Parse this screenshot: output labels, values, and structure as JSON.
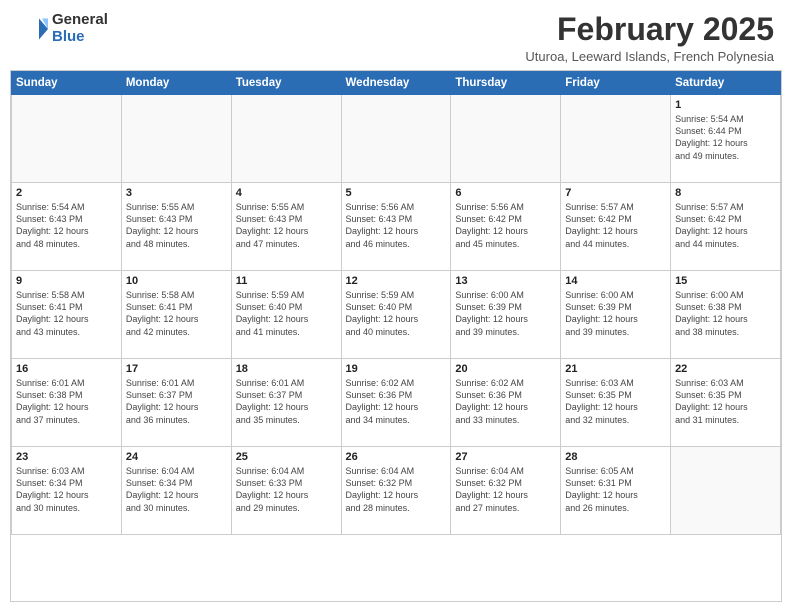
{
  "header": {
    "logo": {
      "general": "General",
      "blue": "Blue"
    },
    "title": "February 2025",
    "subtitle": "Uturoa, Leeward Islands, French Polynesia"
  },
  "days_of_week": [
    "Sunday",
    "Monday",
    "Tuesday",
    "Wednesday",
    "Thursday",
    "Friday",
    "Saturday"
  ],
  "weeks": [
    [
      {
        "day": null,
        "info": null
      },
      {
        "day": null,
        "info": null
      },
      {
        "day": null,
        "info": null
      },
      {
        "day": null,
        "info": null
      },
      {
        "day": null,
        "info": null
      },
      {
        "day": null,
        "info": null
      },
      {
        "day": "1",
        "info": "Sunrise: 5:54 AM\nSunset: 6:44 PM\nDaylight: 12 hours\nand 49 minutes."
      }
    ],
    [
      {
        "day": "2",
        "info": "Sunrise: 5:54 AM\nSunset: 6:43 PM\nDaylight: 12 hours\nand 48 minutes."
      },
      {
        "day": "3",
        "info": "Sunrise: 5:55 AM\nSunset: 6:43 PM\nDaylight: 12 hours\nand 48 minutes."
      },
      {
        "day": "4",
        "info": "Sunrise: 5:55 AM\nSunset: 6:43 PM\nDaylight: 12 hours\nand 47 minutes."
      },
      {
        "day": "5",
        "info": "Sunrise: 5:56 AM\nSunset: 6:43 PM\nDaylight: 12 hours\nand 46 minutes."
      },
      {
        "day": "6",
        "info": "Sunrise: 5:56 AM\nSunset: 6:42 PM\nDaylight: 12 hours\nand 45 minutes."
      },
      {
        "day": "7",
        "info": "Sunrise: 5:57 AM\nSunset: 6:42 PM\nDaylight: 12 hours\nand 44 minutes."
      },
      {
        "day": "8",
        "info": "Sunrise: 5:57 AM\nSunset: 6:42 PM\nDaylight: 12 hours\nand 44 minutes."
      }
    ],
    [
      {
        "day": "9",
        "info": "Sunrise: 5:58 AM\nSunset: 6:41 PM\nDaylight: 12 hours\nand 43 minutes."
      },
      {
        "day": "10",
        "info": "Sunrise: 5:58 AM\nSunset: 6:41 PM\nDaylight: 12 hours\nand 42 minutes."
      },
      {
        "day": "11",
        "info": "Sunrise: 5:59 AM\nSunset: 6:40 PM\nDaylight: 12 hours\nand 41 minutes."
      },
      {
        "day": "12",
        "info": "Sunrise: 5:59 AM\nSunset: 6:40 PM\nDaylight: 12 hours\nand 40 minutes."
      },
      {
        "day": "13",
        "info": "Sunrise: 6:00 AM\nSunset: 6:39 PM\nDaylight: 12 hours\nand 39 minutes."
      },
      {
        "day": "14",
        "info": "Sunrise: 6:00 AM\nSunset: 6:39 PM\nDaylight: 12 hours\nand 39 minutes."
      },
      {
        "day": "15",
        "info": "Sunrise: 6:00 AM\nSunset: 6:38 PM\nDaylight: 12 hours\nand 38 minutes."
      }
    ],
    [
      {
        "day": "16",
        "info": "Sunrise: 6:01 AM\nSunset: 6:38 PM\nDaylight: 12 hours\nand 37 minutes."
      },
      {
        "day": "17",
        "info": "Sunrise: 6:01 AM\nSunset: 6:37 PM\nDaylight: 12 hours\nand 36 minutes."
      },
      {
        "day": "18",
        "info": "Sunrise: 6:01 AM\nSunset: 6:37 PM\nDaylight: 12 hours\nand 35 minutes."
      },
      {
        "day": "19",
        "info": "Sunrise: 6:02 AM\nSunset: 6:36 PM\nDaylight: 12 hours\nand 34 minutes."
      },
      {
        "day": "20",
        "info": "Sunrise: 6:02 AM\nSunset: 6:36 PM\nDaylight: 12 hours\nand 33 minutes."
      },
      {
        "day": "21",
        "info": "Sunrise: 6:03 AM\nSunset: 6:35 PM\nDaylight: 12 hours\nand 32 minutes."
      },
      {
        "day": "22",
        "info": "Sunrise: 6:03 AM\nSunset: 6:35 PM\nDaylight: 12 hours\nand 31 minutes."
      }
    ],
    [
      {
        "day": "23",
        "info": "Sunrise: 6:03 AM\nSunset: 6:34 PM\nDaylight: 12 hours\nand 30 minutes."
      },
      {
        "day": "24",
        "info": "Sunrise: 6:04 AM\nSunset: 6:34 PM\nDaylight: 12 hours\nand 30 minutes."
      },
      {
        "day": "25",
        "info": "Sunrise: 6:04 AM\nSunset: 6:33 PM\nDaylight: 12 hours\nand 29 minutes."
      },
      {
        "day": "26",
        "info": "Sunrise: 6:04 AM\nSunset: 6:32 PM\nDaylight: 12 hours\nand 28 minutes."
      },
      {
        "day": "27",
        "info": "Sunrise: 6:04 AM\nSunset: 6:32 PM\nDaylight: 12 hours\nand 27 minutes."
      },
      {
        "day": "28",
        "info": "Sunrise: 6:05 AM\nSunset: 6:31 PM\nDaylight: 12 hours\nand 26 minutes."
      },
      {
        "day": null,
        "info": null
      }
    ]
  ]
}
